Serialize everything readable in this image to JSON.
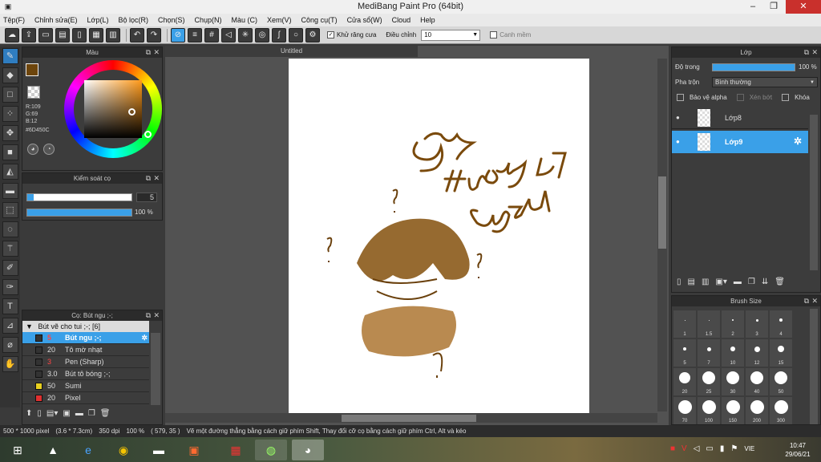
{
  "app": {
    "title": "MediBang Paint Pro (64bit)"
  },
  "menu": [
    "Tệp(F)",
    "Chỉnh sửa(E)",
    "Lớp(L)",
    "Bộ lọc(R)",
    "Chọn(S)",
    "Chụp(N)",
    "Màu (C)",
    "Xem(V)",
    "Công cụ(T)",
    "Cửa sổ(W)",
    "Cloud",
    "Help"
  ],
  "toolbar": {
    "antialias_label": "Khử răng cưa",
    "adjust_label": "Điều chỉnh",
    "adjust_value": "10",
    "smooth_label": "Canh mềm"
  },
  "color_panel": {
    "title": "Màu",
    "r": "R:109",
    "g": "G:69",
    "b": "B:12",
    "hex": "#6D450C",
    "primary": "#6D450C",
    "secondary": "#8aa8d8"
  },
  "brush_control": {
    "title": "Kiểm soát cọ",
    "size": "5",
    "opacity": "100 %",
    "opacity_fraction": 1.0
  },
  "brush_panel": {
    "title": "Cọ: Bút ngu ;-;",
    "group": "Bút vẽ cho tui ;-; [6]",
    "items": [
      {
        "size": "5",
        "name": "Bút ngu ;-;",
        "color": "#333333",
        "selected": true
      },
      {
        "size": "20",
        "name": "Tô mờ nhạt",
        "color": "#333333",
        "selected": false
      },
      {
        "size": "3",
        "name": "Pen (Sharp)",
        "color": "#333333",
        "selected": false
      },
      {
        "size": "3.0",
        "name": "Bút tô bóng ;-;",
        "color": "#333333",
        "selected": false
      },
      {
        "size": "50",
        "name": "Sumi",
        "color": "#e8d020",
        "selected": false
      },
      {
        "size": "20",
        "name": "Pixel",
        "color": "#e03030",
        "selected": false
      }
    ]
  },
  "canvas": {
    "doc_title": "Untitled"
  },
  "layer_panel": {
    "title": "Lớp",
    "opacity_label": "Độ trong",
    "opacity_value": "100 %",
    "opacity_fraction": 1.0,
    "blend_label": "Pha trộn",
    "blend_value": "Bình thường",
    "protect_alpha": "Bảo vệ alpha",
    "clip": "Xén bớt",
    "lock": "Khóa",
    "layers": [
      {
        "name": "Lớp8",
        "selected": false
      },
      {
        "name": "Lớp9",
        "selected": true
      }
    ]
  },
  "brush_size_panel": {
    "title": "Brush Size",
    "sizes": [
      "1",
      "1.5",
      "2",
      "3",
      "4",
      "5",
      "7",
      "10",
      "12",
      "15",
      "20",
      "25",
      "30",
      "40",
      "50",
      "70",
      "100",
      "150",
      "200",
      "300"
    ]
  },
  "status": {
    "pixels": "500 * 1000 pixel",
    "cm": "(3.6 * 7.3cm)",
    "dpi": "350 dpi",
    "zoom": "100 %",
    "coords": "( 579, 35 )",
    "hint": "Vẽ một đường thẳng bằng cách giữ phím Shift, Thay đổi cỡ cọ bằng cách giữ phím Ctrl, Alt và kéo"
  },
  "taskbar": {
    "lang": "VIE",
    "time": "10:47",
    "date": "29/06/21"
  },
  "colors": {
    "accent": "#3aa0e8",
    "drawing": "#7a4a0c"
  }
}
